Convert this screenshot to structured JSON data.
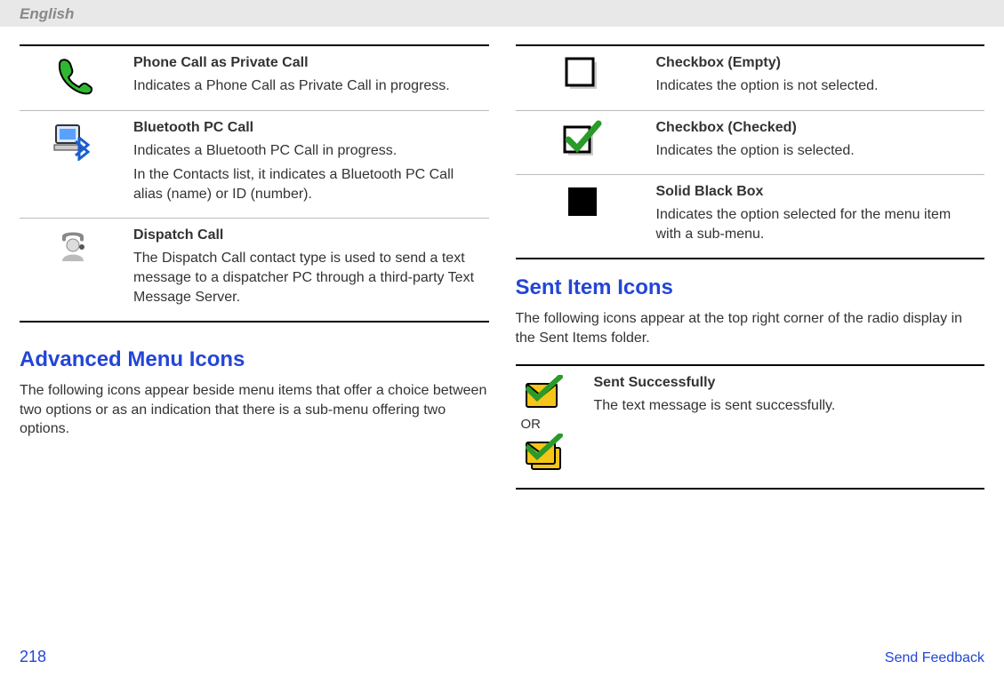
{
  "language": "English",
  "page_number": "218",
  "feedback": "Send Feedback",
  "left_table": [
    {
      "title": "Phone Call as Private Call",
      "desc": [
        "Indicates a Phone Call as Private Call in progress."
      ]
    },
    {
      "title": "Bluetooth PC Call",
      "desc": [
        "Indicates a Bluetooth PC Call in progress.",
        "In the Contacts list, it indicates a Bluetooth PC Call alias (name) or ID (number)."
      ]
    },
    {
      "title": "Dispatch Call",
      "desc": [
        "The Dispatch Call contact type is used to send a text message to a dispatcher PC through a third-party Text Message Server."
      ]
    }
  ],
  "advanced_heading": "Advanced Menu Icons",
  "advanced_intro": "The following icons appear beside menu items that offer a choice between two options or as an indication that there is a sub-menu offering two options.",
  "right_table": [
    {
      "title": "Checkbox (Empty)",
      "desc": [
        "Indicates the option is not selected."
      ]
    },
    {
      "title": "Checkbox (Checked)",
      "desc": [
        "Indicates the option is selected."
      ]
    },
    {
      "title": "Solid Black Box",
      "desc": [
        "Indicates the option selected for the menu item with a sub-menu."
      ]
    }
  ],
  "sent_heading": "Sent Item Icons",
  "sent_intro": "The following icons appear at the top right corner of the radio display in the Sent Items folder.",
  "sent_table": [
    {
      "title": "Sent Successfully",
      "desc": [
        "The text message is sent successfully."
      ],
      "or": "OR"
    }
  ]
}
